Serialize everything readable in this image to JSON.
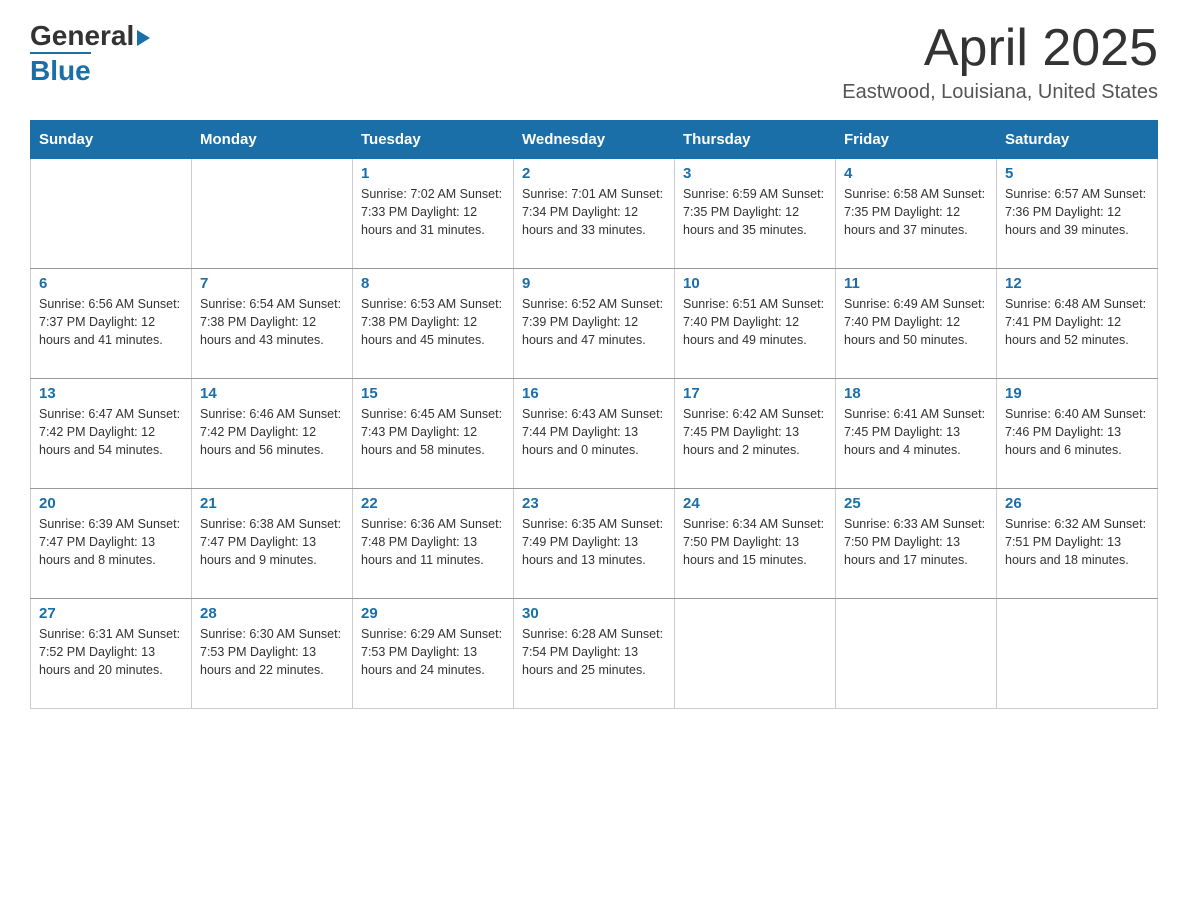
{
  "header": {
    "logo": {
      "general": "General",
      "blue": "Blue",
      "arrow": "▶"
    },
    "title": "April 2025",
    "location": "Eastwood, Louisiana, United States"
  },
  "days_of_week": [
    "Sunday",
    "Monday",
    "Tuesday",
    "Wednesday",
    "Thursday",
    "Friday",
    "Saturday"
  ],
  "weeks": [
    [
      {
        "day": "",
        "info": ""
      },
      {
        "day": "",
        "info": ""
      },
      {
        "day": "1",
        "info": "Sunrise: 7:02 AM\nSunset: 7:33 PM\nDaylight: 12 hours\nand 31 minutes."
      },
      {
        "day": "2",
        "info": "Sunrise: 7:01 AM\nSunset: 7:34 PM\nDaylight: 12 hours\nand 33 minutes."
      },
      {
        "day": "3",
        "info": "Sunrise: 6:59 AM\nSunset: 7:35 PM\nDaylight: 12 hours\nand 35 minutes."
      },
      {
        "day": "4",
        "info": "Sunrise: 6:58 AM\nSunset: 7:35 PM\nDaylight: 12 hours\nand 37 minutes."
      },
      {
        "day": "5",
        "info": "Sunrise: 6:57 AM\nSunset: 7:36 PM\nDaylight: 12 hours\nand 39 minutes."
      }
    ],
    [
      {
        "day": "6",
        "info": "Sunrise: 6:56 AM\nSunset: 7:37 PM\nDaylight: 12 hours\nand 41 minutes."
      },
      {
        "day": "7",
        "info": "Sunrise: 6:54 AM\nSunset: 7:38 PM\nDaylight: 12 hours\nand 43 minutes."
      },
      {
        "day": "8",
        "info": "Sunrise: 6:53 AM\nSunset: 7:38 PM\nDaylight: 12 hours\nand 45 minutes."
      },
      {
        "day": "9",
        "info": "Sunrise: 6:52 AM\nSunset: 7:39 PM\nDaylight: 12 hours\nand 47 minutes."
      },
      {
        "day": "10",
        "info": "Sunrise: 6:51 AM\nSunset: 7:40 PM\nDaylight: 12 hours\nand 49 minutes."
      },
      {
        "day": "11",
        "info": "Sunrise: 6:49 AM\nSunset: 7:40 PM\nDaylight: 12 hours\nand 50 minutes."
      },
      {
        "day": "12",
        "info": "Sunrise: 6:48 AM\nSunset: 7:41 PM\nDaylight: 12 hours\nand 52 minutes."
      }
    ],
    [
      {
        "day": "13",
        "info": "Sunrise: 6:47 AM\nSunset: 7:42 PM\nDaylight: 12 hours\nand 54 minutes."
      },
      {
        "day": "14",
        "info": "Sunrise: 6:46 AM\nSunset: 7:42 PM\nDaylight: 12 hours\nand 56 minutes."
      },
      {
        "day": "15",
        "info": "Sunrise: 6:45 AM\nSunset: 7:43 PM\nDaylight: 12 hours\nand 58 minutes."
      },
      {
        "day": "16",
        "info": "Sunrise: 6:43 AM\nSunset: 7:44 PM\nDaylight: 13 hours\nand 0 minutes."
      },
      {
        "day": "17",
        "info": "Sunrise: 6:42 AM\nSunset: 7:45 PM\nDaylight: 13 hours\nand 2 minutes."
      },
      {
        "day": "18",
        "info": "Sunrise: 6:41 AM\nSunset: 7:45 PM\nDaylight: 13 hours\nand 4 minutes."
      },
      {
        "day": "19",
        "info": "Sunrise: 6:40 AM\nSunset: 7:46 PM\nDaylight: 13 hours\nand 6 minutes."
      }
    ],
    [
      {
        "day": "20",
        "info": "Sunrise: 6:39 AM\nSunset: 7:47 PM\nDaylight: 13 hours\nand 8 minutes."
      },
      {
        "day": "21",
        "info": "Sunrise: 6:38 AM\nSunset: 7:47 PM\nDaylight: 13 hours\nand 9 minutes."
      },
      {
        "day": "22",
        "info": "Sunrise: 6:36 AM\nSunset: 7:48 PM\nDaylight: 13 hours\nand 11 minutes."
      },
      {
        "day": "23",
        "info": "Sunrise: 6:35 AM\nSunset: 7:49 PM\nDaylight: 13 hours\nand 13 minutes."
      },
      {
        "day": "24",
        "info": "Sunrise: 6:34 AM\nSunset: 7:50 PM\nDaylight: 13 hours\nand 15 minutes."
      },
      {
        "day": "25",
        "info": "Sunrise: 6:33 AM\nSunset: 7:50 PM\nDaylight: 13 hours\nand 17 minutes."
      },
      {
        "day": "26",
        "info": "Sunrise: 6:32 AM\nSunset: 7:51 PM\nDaylight: 13 hours\nand 18 minutes."
      }
    ],
    [
      {
        "day": "27",
        "info": "Sunrise: 6:31 AM\nSunset: 7:52 PM\nDaylight: 13 hours\nand 20 minutes."
      },
      {
        "day": "28",
        "info": "Sunrise: 6:30 AM\nSunset: 7:53 PM\nDaylight: 13 hours\nand 22 minutes."
      },
      {
        "day": "29",
        "info": "Sunrise: 6:29 AM\nSunset: 7:53 PM\nDaylight: 13 hours\nand 24 minutes."
      },
      {
        "day": "30",
        "info": "Sunrise: 6:28 AM\nSunset: 7:54 PM\nDaylight: 13 hours\nand 25 minutes."
      },
      {
        "day": "",
        "info": ""
      },
      {
        "day": "",
        "info": ""
      },
      {
        "day": "",
        "info": ""
      }
    ]
  ]
}
